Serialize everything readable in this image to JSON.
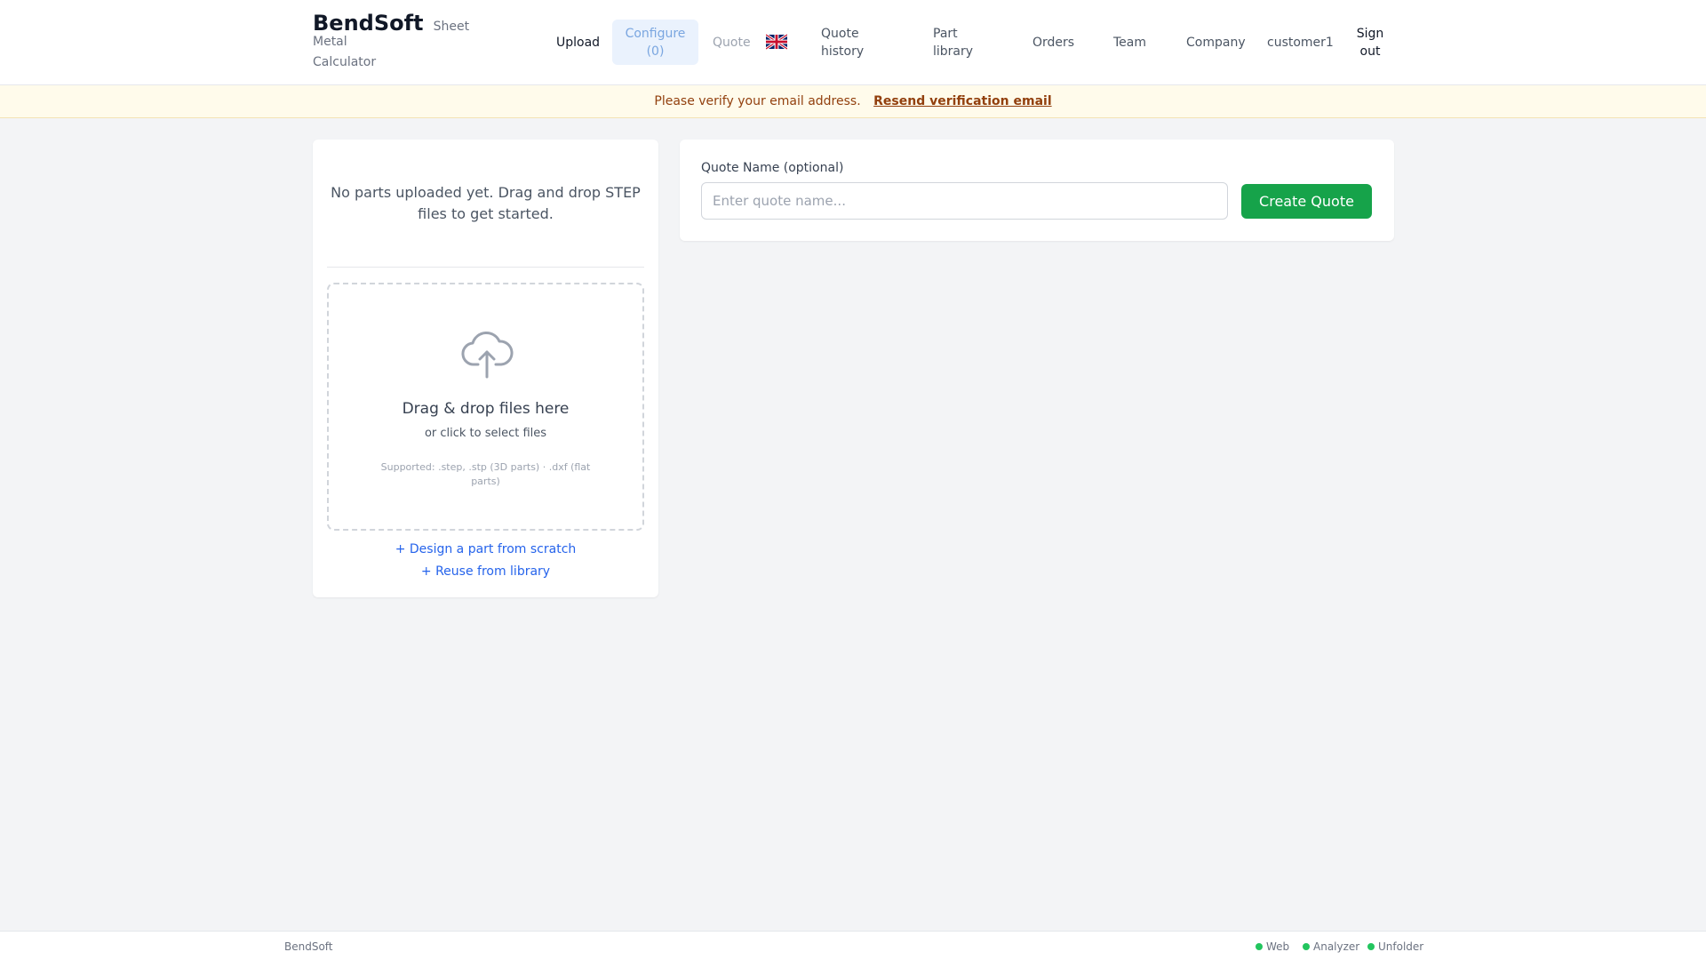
{
  "header": {
    "brand": "BendSoft",
    "subtitle_1": "Sheet Metal",
    "subtitle_2": "Calculator",
    "nav": {
      "upload": "Upload",
      "configure_1": "Configure",
      "configure_2": "(0)",
      "quote": "Quote",
      "quote_history_1": "Quote",
      "quote_history_2": "history",
      "part_library_1": "Part",
      "part_library_2": "library",
      "orders": "Orders",
      "team": "Team",
      "company": "Company",
      "user": "customer1",
      "sign_out_1": "Sign",
      "sign_out_2": "out"
    },
    "language_icon": "uk-flag-icon"
  },
  "banner": {
    "message": "Please verify your email address.",
    "link": "Resend verification email"
  },
  "parts_panel": {
    "empty_message": "No parts uploaded yet. Drag and drop STEP files to get started.",
    "dropzone": {
      "icon": "cloud-upload-icon",
      "title": "Drag & drop files here",
      "subtitle": "or click to select files",
      "hint": "Supported: .step, .stp (3D parts) · .dxf (flat parts)"
    },
    "design_link": "+ Design a part from scratch",
    "reuse_link": "+ Reuse from library"
  },
  "quote_panel": {
    "label": "Quote Name (optional)",
    "placeholder": "Enter quote name...",
    "value": "",
    "button": "Create Quote"
  },
  "footer": {
    "brand": "BendSoft",
    "services": {
      "web": "Web",
      "analyzer": "Analyzer",
      "unfolder": "Unfolder"
    },
    "status_color": "#22c55e"
  },
  "colors": {
    "primary_button": "#16a34a",
    "link": "#2563eb",
    "banner_bg": "#fffbeb",
    "banner_text": "#92400e"
  }
}
